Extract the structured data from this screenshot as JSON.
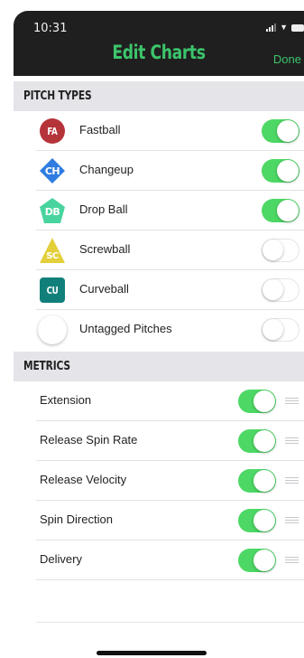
{
  "status_bar": {
    "time": "10:31"
  },
  "nav": {
    "title": "Edit Charts",
    "done_label": "Done",
    "accent": "#3cc56b"
  },
  "pitch_types": {
    "header": "PITCH TYPES",
    "items": [
      {
        "abbr": "FA",
        "label": "Fastball",
        "enabled": true,
        "badge_color": "#b5343a",
        "badge_shape": "circle"
      },
      {
        "abbr": "CH",
        "label": "Changeup",
        "enabled": true,
        "badge_color": "#2e7ce0",
        "badge_shape": "diamond"
      },
      {
        "abbr": "DB",
        "label": "Drop Ball",
        "enabled": true,
        "badge_color": "#49d49e",
        "badge_shape": "pentagon"
      },
      {
        "abbr": "SC",
        "label": "Screwball",
        "enabled": false,
        "badge_color": "#e3cf3a",
        "badge_shape": "triangle"
      },
      {
        "abbr": "CU",
        "label": "Curveball",
        "enabled": false,
        "badge_color": "#12807a",
        "badge_shape": "square"
      },
      {
        "abbr": "",
        "label": "Untagged Pitches",
        "enabled": false,
        "badge_color": "#ffffff",
        "badge_shape": "circle-outline"
      }
    ]
  },
  "metrics": {
    "header": "METRICS",
    "items": [
      {
        "label": "Extension",
        "enabled": true
      },
      {
        "label": "Release Spin Rate",
        "enabled": true
      },
      {
        "label": "Release Velocity",
        "enabled": true
      },
      {
        "label": "Spin Direction",
        "enabled": true
      },
      {
        "label": "Delivery",
        "enabled": true
      }
    ]
  },
  "icons": {
    "drag_handle": "drag-handle-icon"
  }
}
